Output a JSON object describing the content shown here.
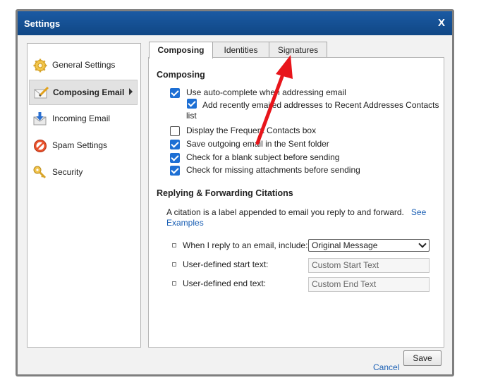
{
  "dialog": {
    "title": "Settings",
    "close_label": "X"
  },
  "sidebar": {
    "items": [
      {
        "label": "General Settings",
        "icon": "gear-icon"
      },
      {
        "label": "Composing Email",
        "icon": "compose-icon",
        "active": true
      },
      {
        "label": "Incoming Email",
        "icon": "inbox-icon"
      },
      {
        "label": "Spam Settings",
        "icon": "no-entry-icon"
      },
      {
        "label": "Security",
        "icon": "key-icon"
      }
    ]
  },
  "tabs": [
    {
      "label": "Composing",
      "active": true
    },
    {
      "label": "Identities"
    },
    {
      "label": "Signatures"
    }
  ],
  "composing": {
    "heading": "Composing",
    "options": {
      "autocomplete": {
        "label": "Use auto-complete when addressing email",
        "checked": true
      },
      "add_recent": {
        "label": "Add recently emailed addresses to Recent Addresses Contacts",
        "label_cont": "list",
        "checked": true
      },
      "frequent": {
        "label": "Display the Frequent Contacts box",
        "checked": false
      },
      "save_sent": {
        "label": "Save outgoing email in the Sent folder",
        "checked": true
      },
      "blank_subject": {
        "label": "Check for a blank subject before sending",
        "checked": true
      },
      "missing_attach": {
        "label": "Check for missing attachments before sending",
        "checked": true
      }
    }
  },
  "citations": {
    "heading": "Replying & Forwarding Citations",
    "description": "A citation is a label appended to email you reply to and forward.",
    "link_see": "See",
    "link_examples": "Examples",
    "reply_label": "When I reply to an email, include:",
    "reply_value": "Original Message",
    "start_label": "User-defined start text:",
    "start_placeholder": "Custom Start Text",
    "end_label": "User-defined end text:",
    "end_placeholder": "Custom End Text"
  },
  "footer": {
    "cancel": "Cancel",
    "save": "Save"
  },
  "colors": {
    "titlebar": "#1b5aa3",
    "accent": "#1d6fd4",
    "annotation_arrow": "#e8151b"
  }
}
